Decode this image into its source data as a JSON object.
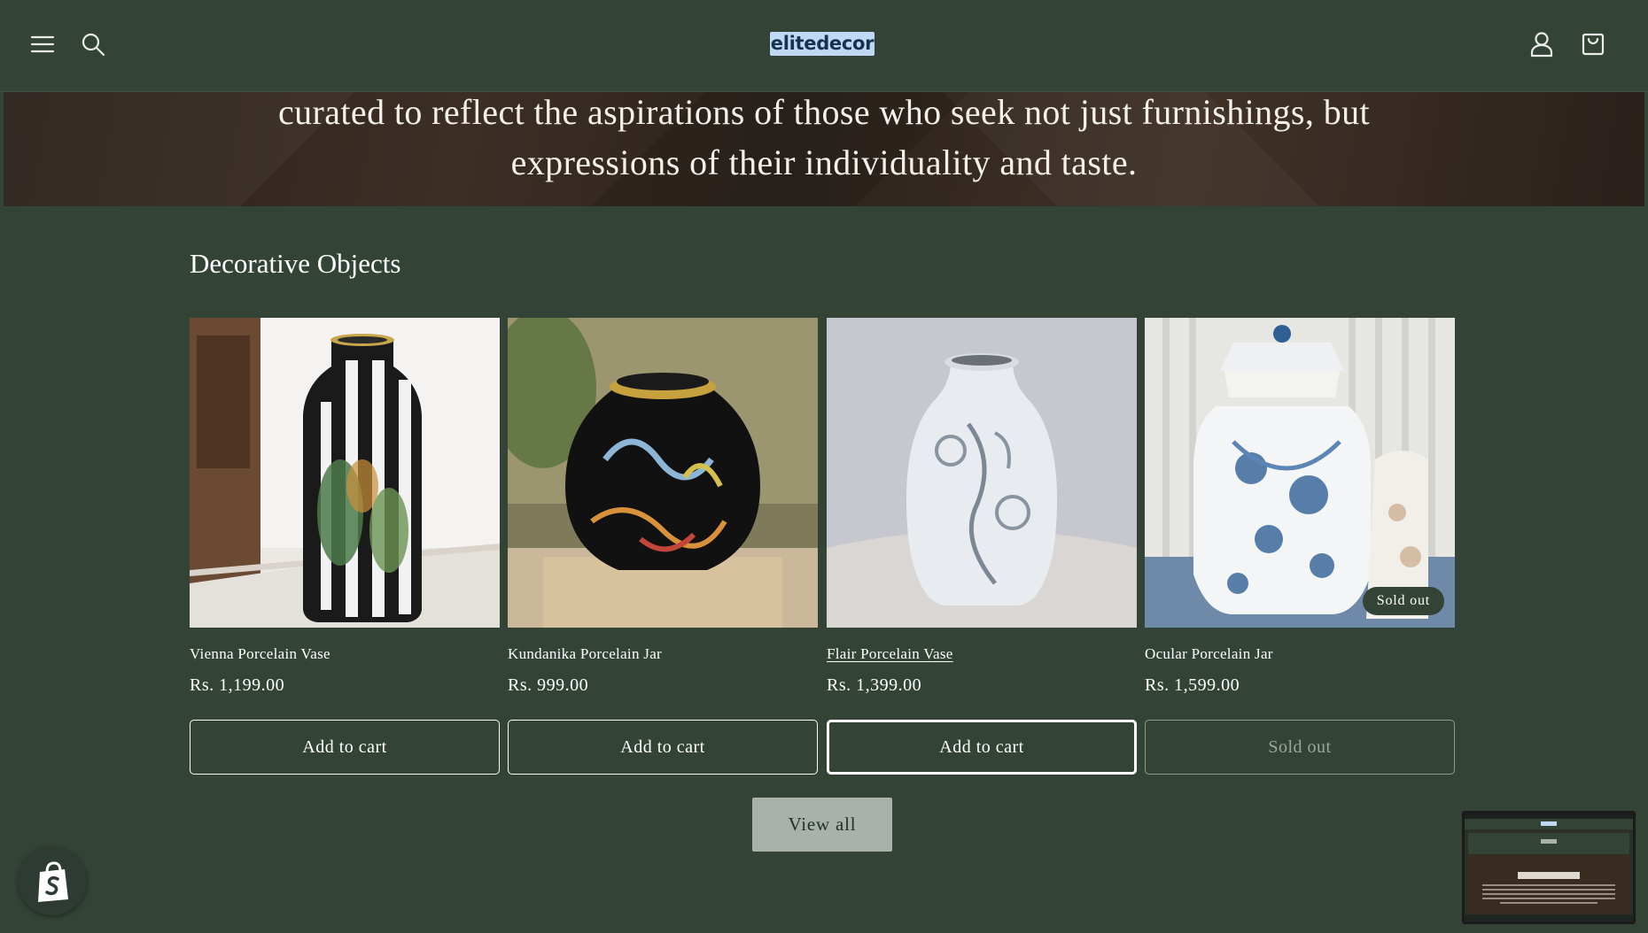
{
  "header": {
    "logo_text": "elitedecor",
    "icons": [
      "menu-icon",
      "search-icon",
      "account-icon",
      "cart-icon"
    ]
  },
  "hero": {
    "text": "curated to reflect the aspirations of those who seek not just furnishings, but expressions of their individuality and taste."
  },
  "section": {
    "title": "Decorative Objects",
    "view_all_label": "View all"
  },
  "products": [
    {
      "name": "Vienna Porcelain Vase",
      "price": "Rs. 1,199.00",
      "button": "Add to cart"
    },
    {
      "name": "Kundanika Porcelain Jar",
      "price": "Rs. 999.00",
      "button": "Add to cart"
    },
    {
      "name": "Flair Porcelain Vase",
      "price": "Rs. 1,399.00",
      "button": "Add to cart"
    },
    {
      "name": "Ocular Porcelain Jar",
      "price": "Rs. 1,599.00",
      "button": "Sold out",
      "badge": "Sold out"
    }
  ],
  "colors": {
    "background": "#334437",
    "logo_bg": "#bfd9f4",
    "view_all_bg": "#a8b2aa"
  }
}
